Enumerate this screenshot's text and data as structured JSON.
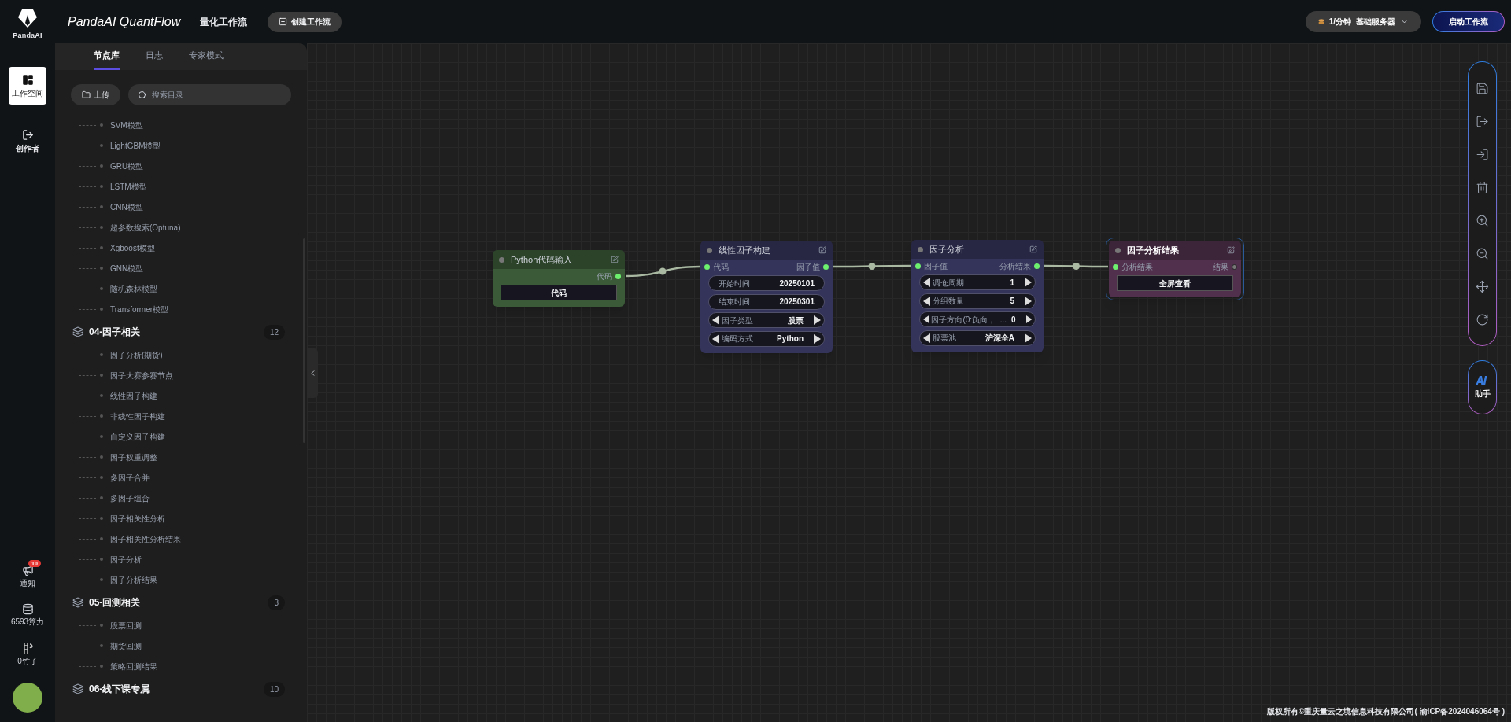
{
  "rail": {
    "logo_text": "PandaAI",
    "items": [
      {
        "label": "工作空间",
        "selected": true
      },
      {
        "label": "创作者",
        "selected": false
      }
    ],
    "footer": [
      {
        "kind": "notice",
        "label": "通知",
        "badge": "10"
      },
      {
        "kind": "power",
        "label": "6593算力"
      },
      {
        "kind": "bamboo",
        "label": "0竹子"
      }
    ]
  },
  "header": {
    "app_title": "PandaAI QuantFlow",
    "page_title": "量化工作流",
    "create_button": "创建工作流",
    "server": {
      "rate": "1/分钟",
      "name": "基础服务器"
    },
    "run_button": "启动工作流"
  },
  "panel": {
    "tabs": [
      {
        "label": "节点库",
        "selected": true
      },
      {
        "label": "日志",
        "selected": false
      },
      {
        "label": "专家模式",
        "selected": false
      }
    ],
    "upload_button": "上传",
    "search": {
      "placeholder": "搜索目录"
    },
    "groups": [
      {
        "children": [
          "SVM模型",
          "LightGBM模型",
          "GRU模型",
          "LSTM模型",
          "CNN模型",
          "超参数搜索(Optuna)",
          "Xgboost模型",
          "GNN模型",
          "随机森林模型",
          "Transformer模型"
        ]
      },
      {
        "label": "04-因子相关",
        "count": "12",
        "children": [
          "因子分析(期货)",
          "因子大赛参赛节点",
          "线性因子构建",
          "非线性因子构建",
          "自定义因子构建",
          "因子权重调整",
          "多因子合并",
          "多因子组合",
          "因子相关性分析",
          "因子相关性分析结果",
          "因子分析",
          "因子分析结果"
        ]
      },
      {
        "label": "05-回测相关",
        "count": "3",
        "children": [
          "股票回测",
          "期货回测",
          "策略回测结果"
        ]
      },
      {
        "label": "06-线下课专属",
        "count": "10"
      }
    ]
  },
  "nodes": [
    {
      "title": "Python代码输入",
      "color": "#3b5a38",
      "selected": false,
      "outputs": [
        {
          "label": "代码",
          "connected": true
        }
      ],
      "widgets": [
        {
          "kind": "button",
          "label": "代码"
        }
      ]
    },
    {
      "title": "线性因子构建",
      "color": "#34335a",
      "selected": false,
      "inputs": [
        {
          "label": "代码",
          "connected": true
        }
      ],
      "outputs": [
        {
          "label": "因子值",
          "connected": true
        }
      ],
      "widgets": [
        {
          "kind": "text",
          "label": "开始时间",
          "value": "20250101"
        },
        {
          "kind": "text",
          "label": "结束时间",
          "value": "20250301"
        },
        {
          "kind": "combo",
          "label": "因子类型",
          "value": "股票"
        },
        {
          "kind": "combo",
          "label": "编码方式",
          "value": "Python"
        }
      ]
    },
    {
      "title": "因子分析",
      "color": "#34335a",
      "selected": false,
      "inputs": [
        {
          "label": "因子值",
          "connected": true
        }
      ],
      "outputs": [
        {
          "label": "分析结果",
          "connected": true
        }
      ],
      "widgets": [
        {
          "kind": "combo",
          "label": "调仓周期",
          "value": "1"
        },
        {
          "kind": "combo",
          "label": "分组数量",
          "value": "5"
        },
        {
          "kind": "combo",
          "label": "因子方向(0:负向，  ...",
          "value": "0"
        },
        {
          "kind": "combo",
          "label": "股票池",
          "value": "沪深全A"
        }
      ]
    },
    {
      "title": "因子分析结果",
      "color": "#50304d",
      "selected": true,
      "inputs": [
        {
          "label": "分析结果",
          "connected": true
        }
      ],
      "outputs": [
        {
          "label": "结果",
          "connected": false
        }
      ],
      "widgets": [
        {
          "kind": "button",
          "label": "全屏查看"
        }
      ]
    }
  ],
  "assistant": {
    "label": "助手"
  },
  "footer": "版权所有©重庆量云之境信息科技有限公司( 渝ICP备2024046064号 )"
}
